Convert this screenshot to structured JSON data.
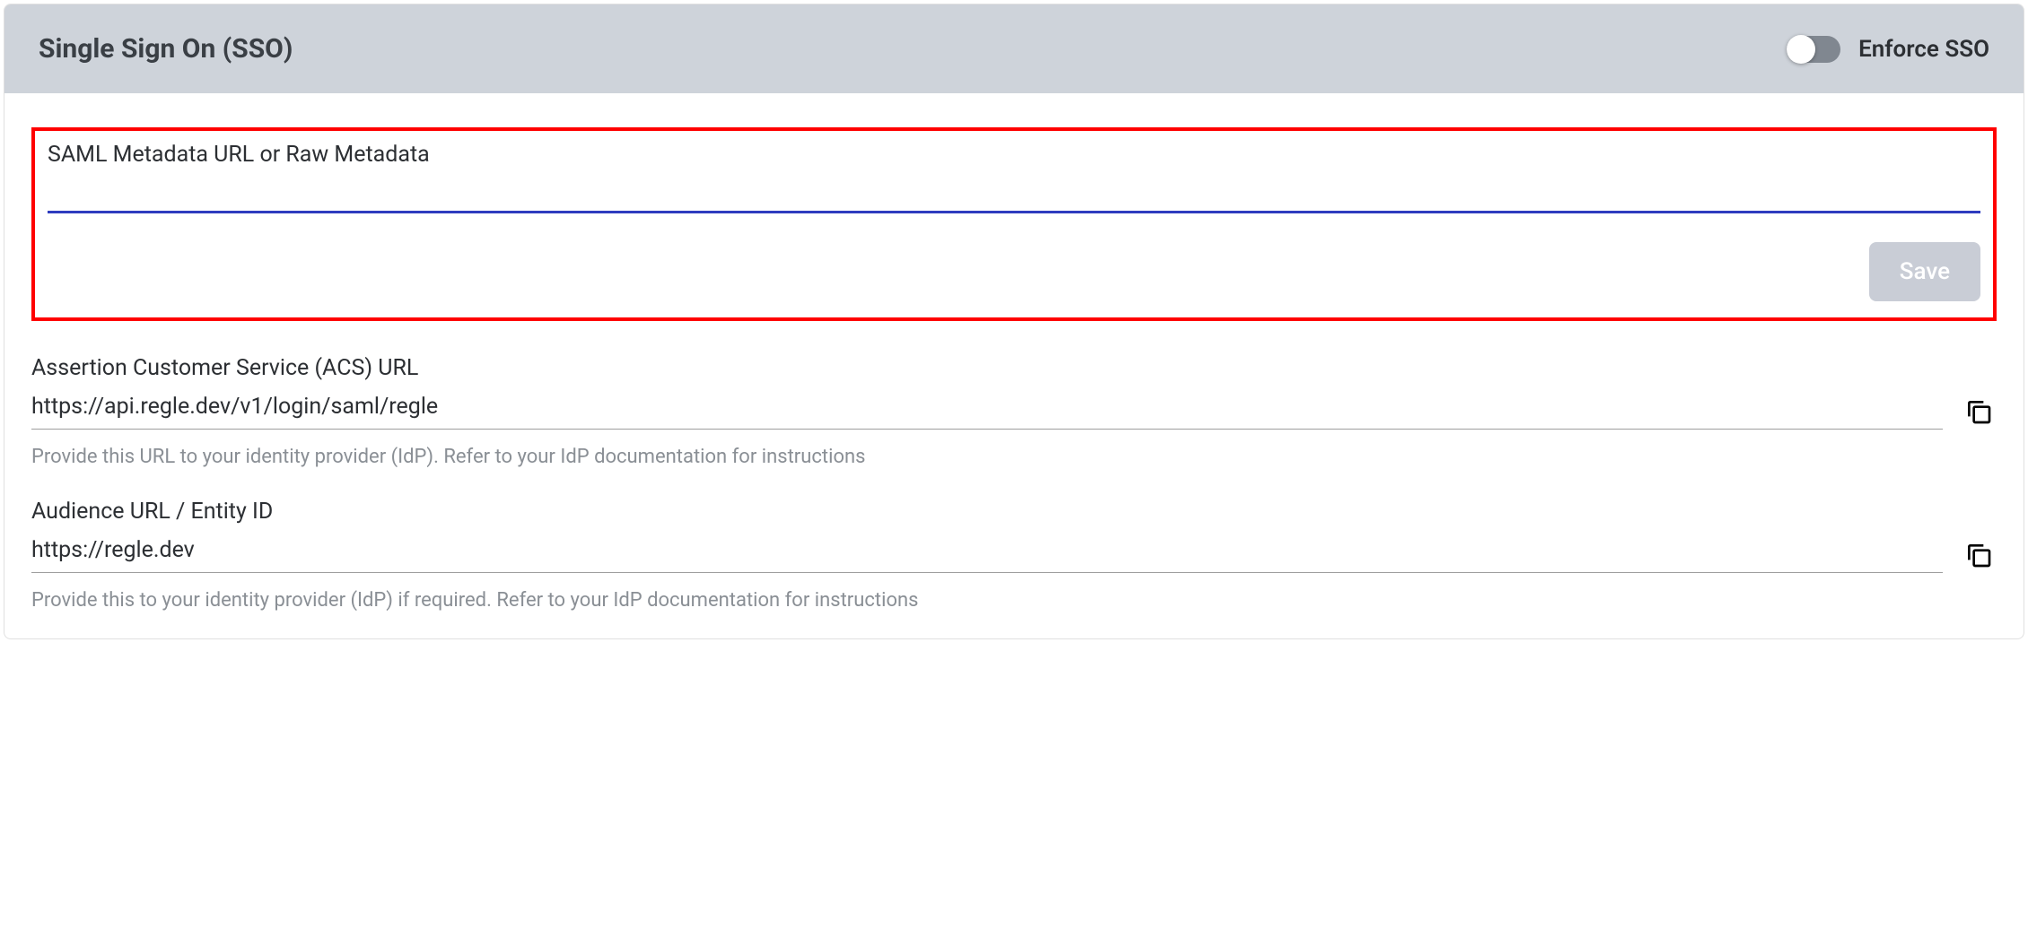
{
  "card": {
    "title": "Single Sign On (SSO)",
    "toggle": {
      "label": "Enforce SSO",
      "state": "off"
    }
  },
  "metadata": {
    "label": "SAML Metadata URL or Raw Metadata",
    "value": "",
    "save_label": "Save"
  },
  "acs": {
    "label": "Assertion Customer Service (ACS) URL",
    "value": "https://api.regle.dev/v1/login/saml/regle",
    "hint": "Provide this URL to your identity provider (IdP). Refer to your IdP documentation for instructions"
  },
  "audience": {
    "label": "Audience URL / Entity ID",
    "value": "https://regle.dev",
    "hint": "Provide this to your identity provider (IdP) if required. Refer to your IdP documentation for instructions"
  }
}
